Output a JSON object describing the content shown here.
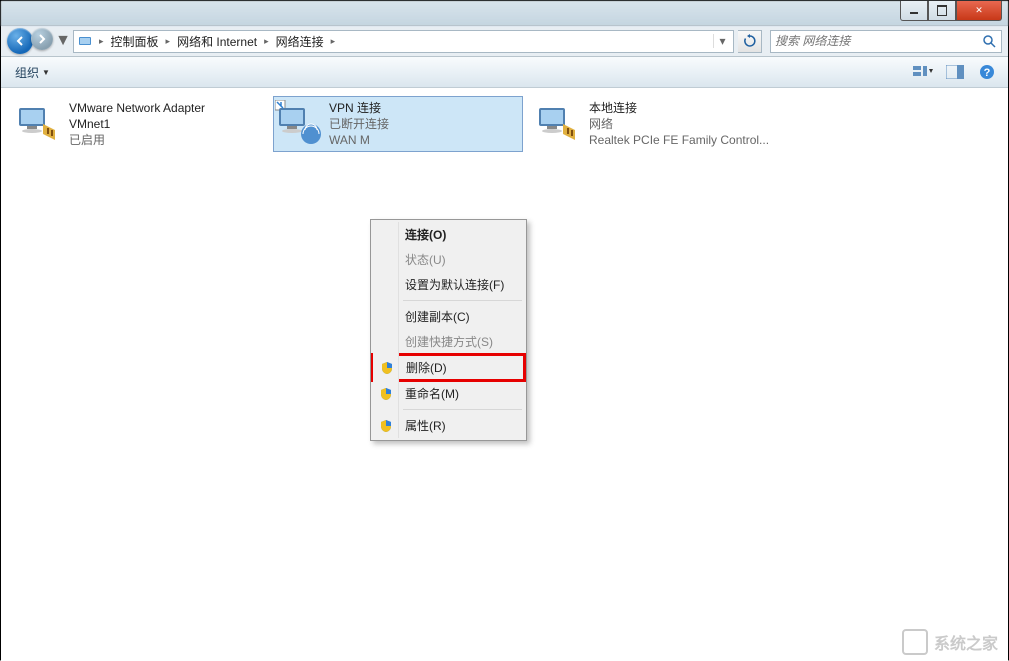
{
  "breadcrumb": {
    "seg1": "控制面板",
    "seg2": "网络和 Internet",
    "seg3": "网络连接"
  },
  "search": {
    "placeholder": "搜索 网络连接"
  },
  "toolbar": {
    "organize": "组织"
  },
  "connections": [
    {
      "title": "VMware Network Adapter",
      "subtitle": "VMnet1",
      "status": "已启用"
    },
    {
      "title": "VPN 连接",
      "subtitle": "已断开连接",
      "status": "WAN M"
    },
    {
      "title": "本地连接",
      "subtitle": "网络",
      "status": "Realtek PCIe FE Family Control..."
    }
  ],
  "contextMenu": {
    "connect": "连接(O)",
    "status": "状态(U)",
    "setDefault": "设置为默认连接(F)",
    "createCopy": "创建副本(C)",
    "createShortcut": "创建快捷方式(S)",
    "delete": "删除(D)",
    "rename": "重命名(M)",
    "properties": "属性(R)"
  },
  "watermark": "系统之家"
}
